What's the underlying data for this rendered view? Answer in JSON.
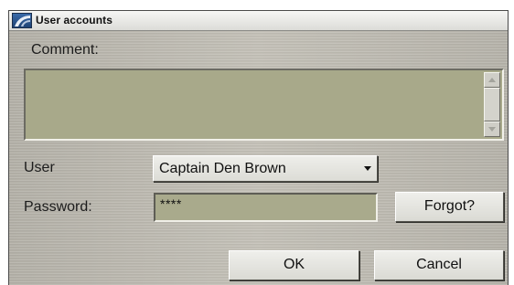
{
  "window": {
    "title": "User accounts",
    "icon": "app-logo-icon"
  },
  "comment": {
    "label": "Comment:",
    "value": ""
  },
  "user": {
    "label": "User",
    "selected": "Captain Den Brown"
  },
  "password": {
    "label": "Password:",
    "value": "****"
  },
  "buttons": {
    "forgot": "Forgot?",
    "ok": "OK",
    "cancel": "Cancel"
  },
  "colors": {
    "panel": "#bdbab1",
    "field": "#a9aa8c",
    "titlebar": "#e8e8e4"
  }
}
